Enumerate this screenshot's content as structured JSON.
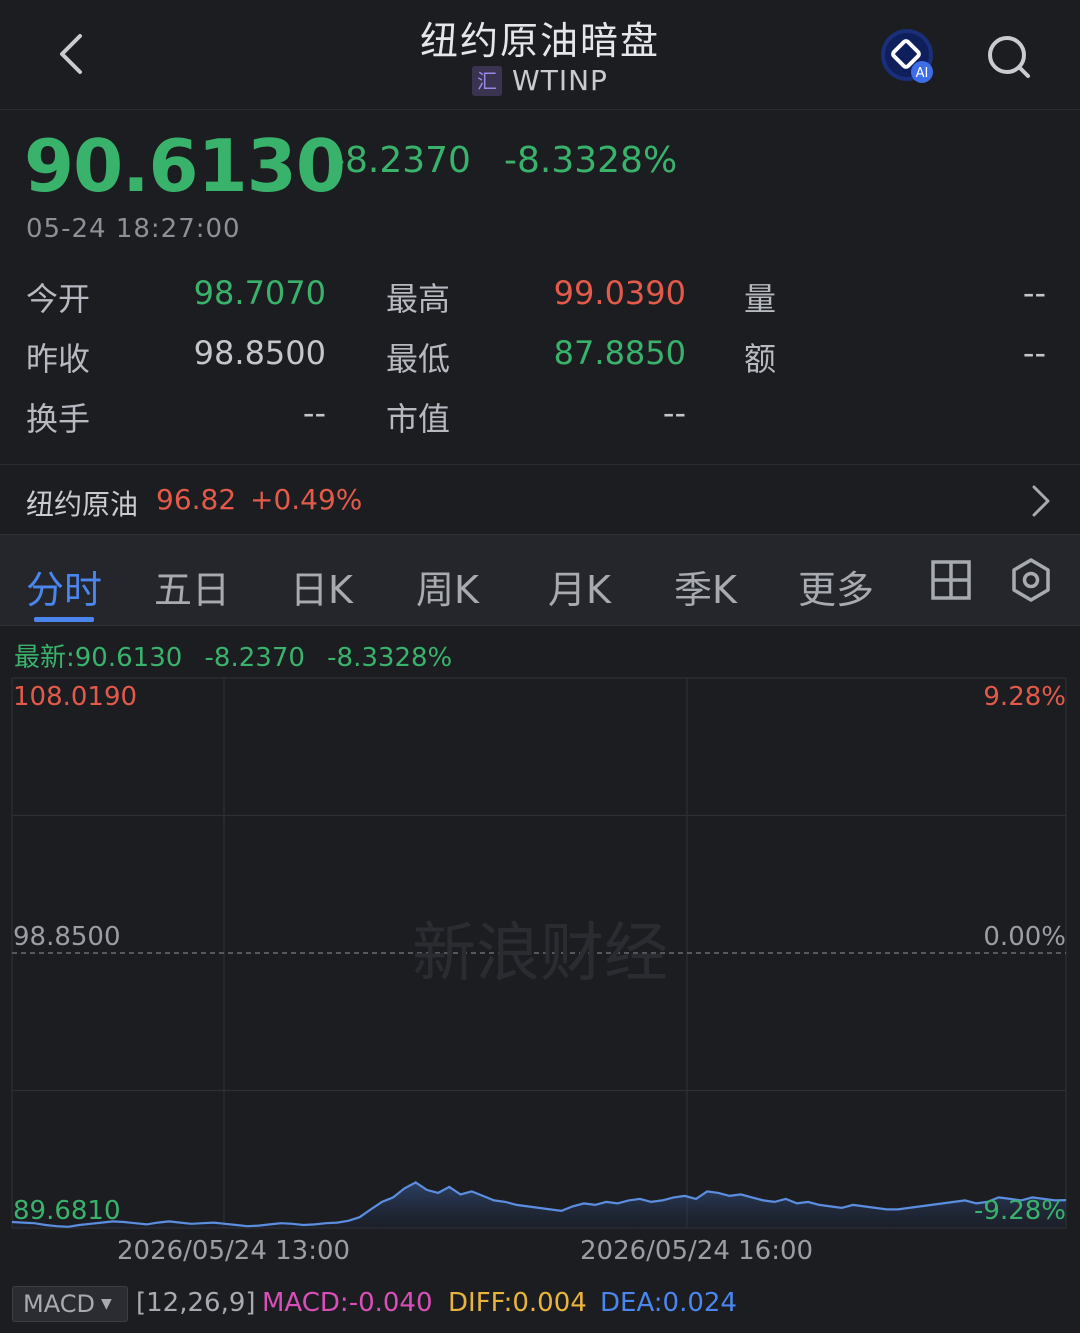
{
  "header": {
    "title": "纽约原油暗盘",
    "exchange_badge": "汇",
    "code": "WTINP",
    "icons": [
      "back-icon",
      "ai-icon",
      "search-icon"
    ],
    "ai_badge": "AI"
  },
  "quote": {
    "price": "90.6130",
    "change": "-8.2370",
    "change_pct": "-8.3328%",
    "timestamp": "05-24 18:27:00"
  },
  "stats": {
    "open_label": "今开",
    "open_value": "98.7070",
    "prev_close_label": "昨收",
    "prev_close_value": "98.8500",
    "turnover_label": "换手",
    "turnover_value": "--",
    "high_label": "最高",
    "high_value": "99.0390",
    "low_label": "最低",
    "low_value": "87.8850",
    "market_cap_label": "市值",
    "market_cap_value": "--",
    "volume_label": "量",
    "volume_value": "--",
    "amount_label": "额",
    "amount_value": "--"
  },
  "related": {
    "name": "纽约原油",
    "price": "96.82",
    "change_pct": "+0.49%"
  },
  "tabs": [
    "分时",
    "五日",
    "日K",
    "周K",
    "月K",
    "季K",
    "更多"
  ],
  "active_tab": 0,
  "latest_line": {
    "prefix": "最新:90.6130",
    "change": "-8.2370",
    "change_pct": "-8.3328%"
  },
  "chart_data": {
    "type": "line",
    "y_max_label": "108.0190",
    "y_mid_label": "98.8500",
    "y_min_label": "89.6810",
    "pct_max_label": "9.28%",
    "pct_mid_label": "0.00%",
    "pct_min_label": "-9.28%",
    "x_tick_labels": [
      "2026/05/24 13:00",
      "2026/05/24 16:00"
    ],
    "ylim": [
      89.681,
      108.019
    ],
    "reference_value": 98.85,
    "watermark": "新浪财经",
    "series": [
      {
        "values": [
          89.88,
          89.86,
          89.84,
          89.78,
          89.74,
          89.72,
          89.78,
          89.82,
          89.86,
          89.9,
          89.88,
          89.84,
          89.8,
          89.86,
          89.9,
          89.86,
          89.82,
          89.84,
          89.86,
          89.82,
          89.78,
          89.74,
          89.76,
          89.8,
          89.84,
          89.82,
          89.78,
          89.8,
          89.84,
          89.86,
          89.92,
          90.04,
          90.3,
          90.55,
          90.7,
          91.0,
          91.2,
          90.95,
          90.85,
          91.05,
          90.8,
          90.9,
          90.75,
          90.6,
          90.55,
          90.45,
          90.4,
          90.35,
          90.3,
          90.25,
          90.4,
          90.5,
          90.45,
          90.55,
          90.5,
          90.6,
          90.65,
          90.55,
          90.6,
          90.7,
          90.75,
          90.65,
          90.9,
          90.85,
          90.75,
          90.8,
          90.7,
          90.6,
          90.55,
          90.65,
          90.5,
          90.55,
          90.45,
          90.4,
          90.35,
          90.45,
          90.4,
          90.35,
          90.3,
          90.3,
          90.35,
          90.4,
          90.45,
          90.5,
          90.55,
          90.6,
          90.5,
          90.55,
          90.7,
          90.65,
          90.6,
          90.7,
          90.65,
          90.6,
          90.61
        ]
      }
    ]
  },
  "indicator": {
    "name": "MACD",
    "params": "[12,26,9]",
    "macd": "MACD:-0.040",
    "diff": "DIFF:0.004",
    "dea": "DEA:0.024"
  },
  "colors": {
    "up": "#e35a4a",
    "down": "#39b36b",
    "accent": "#4a86ee",
    "line": "#5b8ee0",
    "macd": "#d94fb8",
    "diff": "#e8b43e",
    "dea": "#4a86ee"
  }
}
